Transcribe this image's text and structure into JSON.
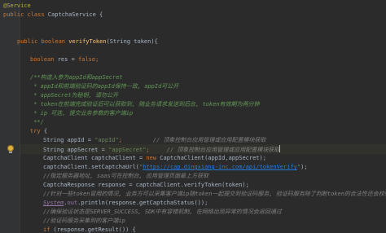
{
  "code": {
    "annotation": "@Service",
    "class_kw": "public class ",
    "class_name": "CaptchaService",
    "class_open": " {",
    "method_kw": "public boolean ",
    "method_name": "verifyToken",
    "method_args": "(String token){",
    "res_kw": "boolean ",
    "res_rest": "res = ",
    "res_false": "false",
    "res_end": ";",
    "doc_1": "/**构造入参为appId和appSecret",
    "doc_2": " * appId和前端验证码的appId保持一致, appId可公开",
    "doc_3": " * appSecret为秘钥, 请勿公开",
    "doc_4": " * token在前端完成验证后可以获取到, 随业务请求发送到后台, token有效期为两分钟",
    "doc_5": " * ip 可选, 提交业务参数的客户端ip",
    "doc_6": " **/",
    "try_kw": "try",
    "try_brace": " {",
    "appid_decl": "String appId = ",
    "appid_val": "\"appId\"",
    "appid_semi": ";",
    "appid_comment": "// 顶象控制台应用管理或应用配置模块获取",
    "appsecret_decl": "String appSecret = ",
    "appsecret_val": "\"appSecret\"",
    "appsecret_semi": ";",
    "appsecret_comment": "// 顶象控制台应用管理或应用配置模块获取",
    "client_decl": "CaptchaClient captchaClient = ",
    "client_new": "new ",
    "client_ctor": "CaptchaClient(appId,appSecret);",
    "seturl_pre": "captchaClient.setCaptchaUrl(",
    "seturl_q1": "\"",
    "seturl_link": "https://cap.dingxiang-inc.com/api/tokenVerify",
    "seturl_q2": "\"",
    "seturl_end": ");",
    "cmt_server": "//指定服务器地址, saas可在控制台, 应用管理页面最上方获取",
    "resp_decl": "CaptchaResponse response = captchaClient.verifyToken(token);",
    "cmt_verify": "//针对一些token冒用的情况, 业务方可以采集客户端ip随token一起提交到验证码服务, 验证码服务除了判断token的合法性还会校验提交业务参数的客户",
    "sysout_sys": "System",
    "sysout_dot": ".",
    "sysout_out": "out",
    "sysout_rest": ".println(response.getCaptchaStatus());",
    "cmt_status": "//确保验证状态是SERVER_SUCCESS, SDK中有容错机制, 在网络出现异常的情况会返回通过",
    "cmt_ip": "//验证码服务采集到的客户端ip",
    "if_kw": "if",
    "if_rest": " (",
    "if_call": "response.getResult",
    "if_end": "()) {"
  }
}
